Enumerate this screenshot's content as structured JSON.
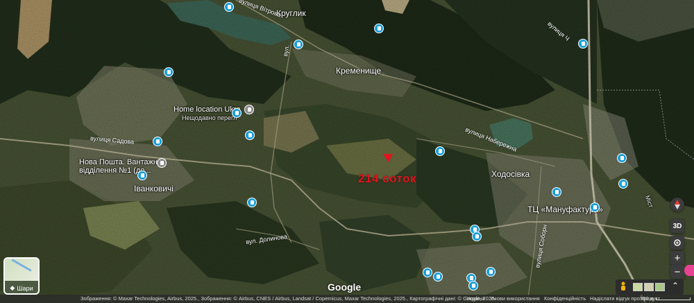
{
  "map": {
    "places": [
      {
        "id": "kruhlyk",
        "text": "Круглик"
      },
      {
        "id": "kremenyshche",
        "text": "Кременище"
      },
      {
        "id": "home",
        "text": "Home location Ukra"
      },
      {
        "id": "home_sub",
        "text": "Нещодавно перегл"
      },
      {
        "id": "np1",
        "text": "Нова Пошта. Вантажне"
      },
      {
        "id": "np2",
        "text": "відділення №1 (до..."
      },
      {
        "id": "ivankovychi",
        "text": "Іванковичі"
      },
      {
        "id": "khodosivka",
        "text": "Ходосівка"
      },
      {
        "id": "tc",
        "text": "ТЦ «Мануфактура»"
      },
      {
        "id": "mist",
        "text": "Міст"
      }
    ],
    "roads": [
      {
        "id": "vitryna",
        "text": "вулиця Вітрова"
      },
      {
        "id": "vul1",
        "text": "вул."
      },
      {
        "id": "sadova",
        "text": "вулиця Садова"
      },
      {
        "id": "naberezhna",
        "text": "вулиця Набережна"
      },
      {
        "id": "dolynova",
        "text": "вул. Долинова"
      },
      {
        "id": "sobornosti",
        "text": "вулиця Соборн"
      },
      {
        "id": "right",
        "text": "вулиця Ч"
      }
    ],
    "plot_label": "214 соток",
    "google_logo": "Google",
    "layers_label": "Шари",
    "attribution": "Зображення: © Maxar Technologies, Airbus, 2025., Зображення: © Airbus, CNES / Airbus, Landsat / Copernicus, Maxar Technologies, 2025., Картографічні дані: © Google, 2025.",
    "footer_links": [
      "Україна",
      "Умови використання",
      "Конфіденційність",
      "Надіслати відгук про продукт",
      "500 м"
    ],
    "controls": {
      "compass": "compass-icon",
      "tilt": "3D",
      "locate": "locate-icon",
      "zoom_in": "+",
      "zoom_out": "−"
    },
    "colors": {
      "pin": "#1a9fd8",
      "plot": "#e0141e",
      "water": "#3f6b5a"
    }
  }
}
